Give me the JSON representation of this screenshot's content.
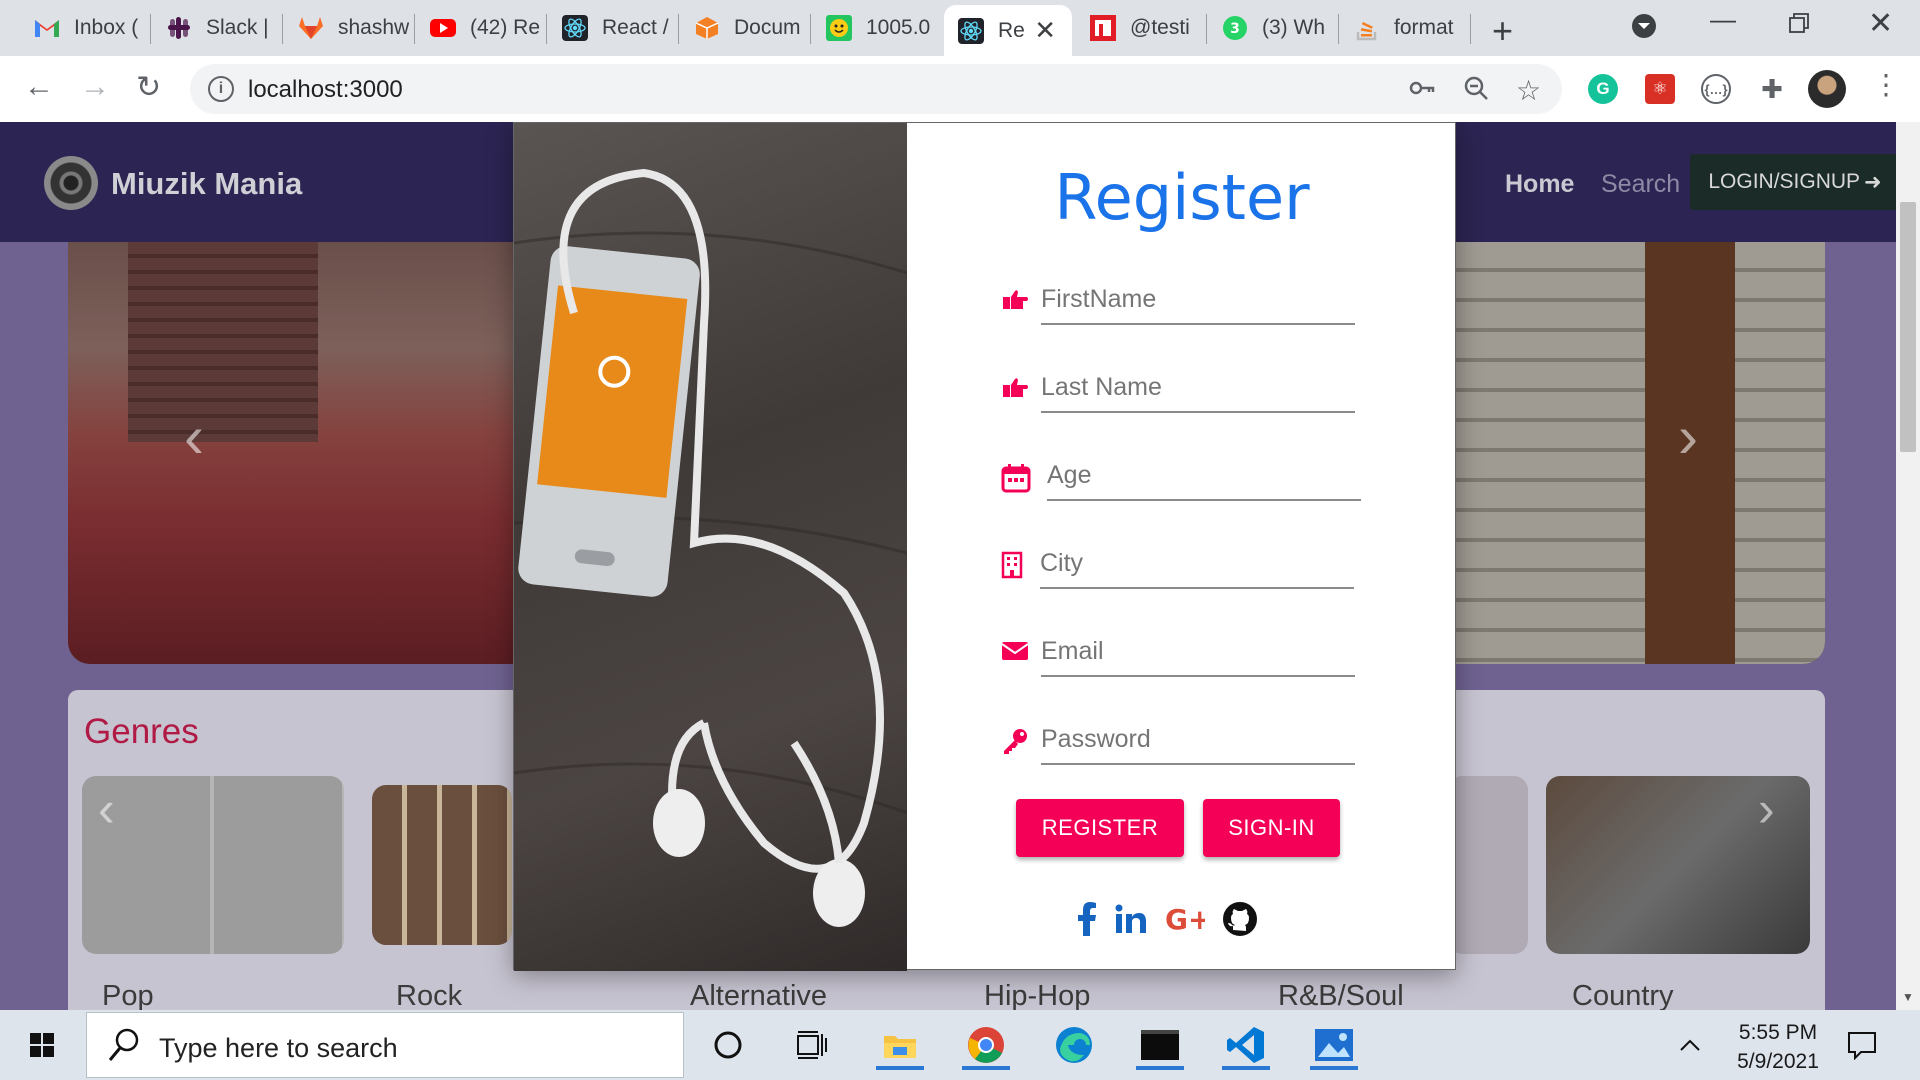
{
  "browser": {
    "tabs": [
      {
        "label": "Inbox (",
        "icon": "gmail-icon"
      },
      {
        "label": "Slack |",
        "icon": "slack-icon"
      },
      {
        "label": "shashw",
        "icon": "gitlab-icon"
      },
      {
        "label": "(42) Re",
        "icon": "youtube-icon"
      },
      {
        "label": "React /",
        "icon": "react-icon"
      },
      {
        "label": "Docum",
        "icon": "codesandbox-icon"
      },
      {
        "label": "1005.0",
        "icon": "smiley-icon"
      },
      {
        "label": "Re",
        "icon": "react-icon",
        "active": true
      },
      {
        "label": "@testi",
        "icon": "netlify-icon"
      },
      {
        "label": "(3) Wh",
        "icon": "whatsapp-icon"
      },
      {
        "label": "format",
        "icon": "stackoverflow-icon"
      }
    ],
    "url": "localhost:3000"
  },
  "site": {
    "brand": "Miuzik Mania",
    "nav": {
      "home": "Home",
      "search": "Search",
      "login": "LOGIN/SIGNUP"
    }
  },
  "genres": {
    "title": "Genres",
    "items": [
      "Pop",
      "Rock",
      "Alternative",
      "Hip-Hop",
      "R&B/Soul",
      "Country"
    ]
  },
  "register_modal": {
    "title": "Register",
    "fields": {
      "firstname": {
        "placeholder": "FirstName",
        "icon": "hand-point-right-icon"
      },
      "lastname": {
        "placeholder": "Last Name",
        "icon": "hand-point-right-icon"
      },
      "age": {
        "placeholder": "Age",
        "icon": "calendar-icon"
      },
      "city": {
        "placeholder": "City",
        "icon": "building-icon"
      },
      "email": {
        "placeholder": "Email",
        "icon": "envelope-icon"
      },
      "password": {
        "placeholder": "Password",
        "icon": "key-icon"
      }
    },
    "buttons": {
      "register": "REGISTER",
      "signin": "SIGN-IN"
    },
    "social": [
      "facebook-icon",
      "linkedin-icon",
      "google-plus-icon",
      "github-icon"
    ],
    "accent_color": "#f50057",
    "title_color": "#1a73e8"
  },
  "taskbar": {
    "search_placeholder": "Type here to search",
    "time": "5:55 PM",
    "date": "5/9/2021"
  }
}
